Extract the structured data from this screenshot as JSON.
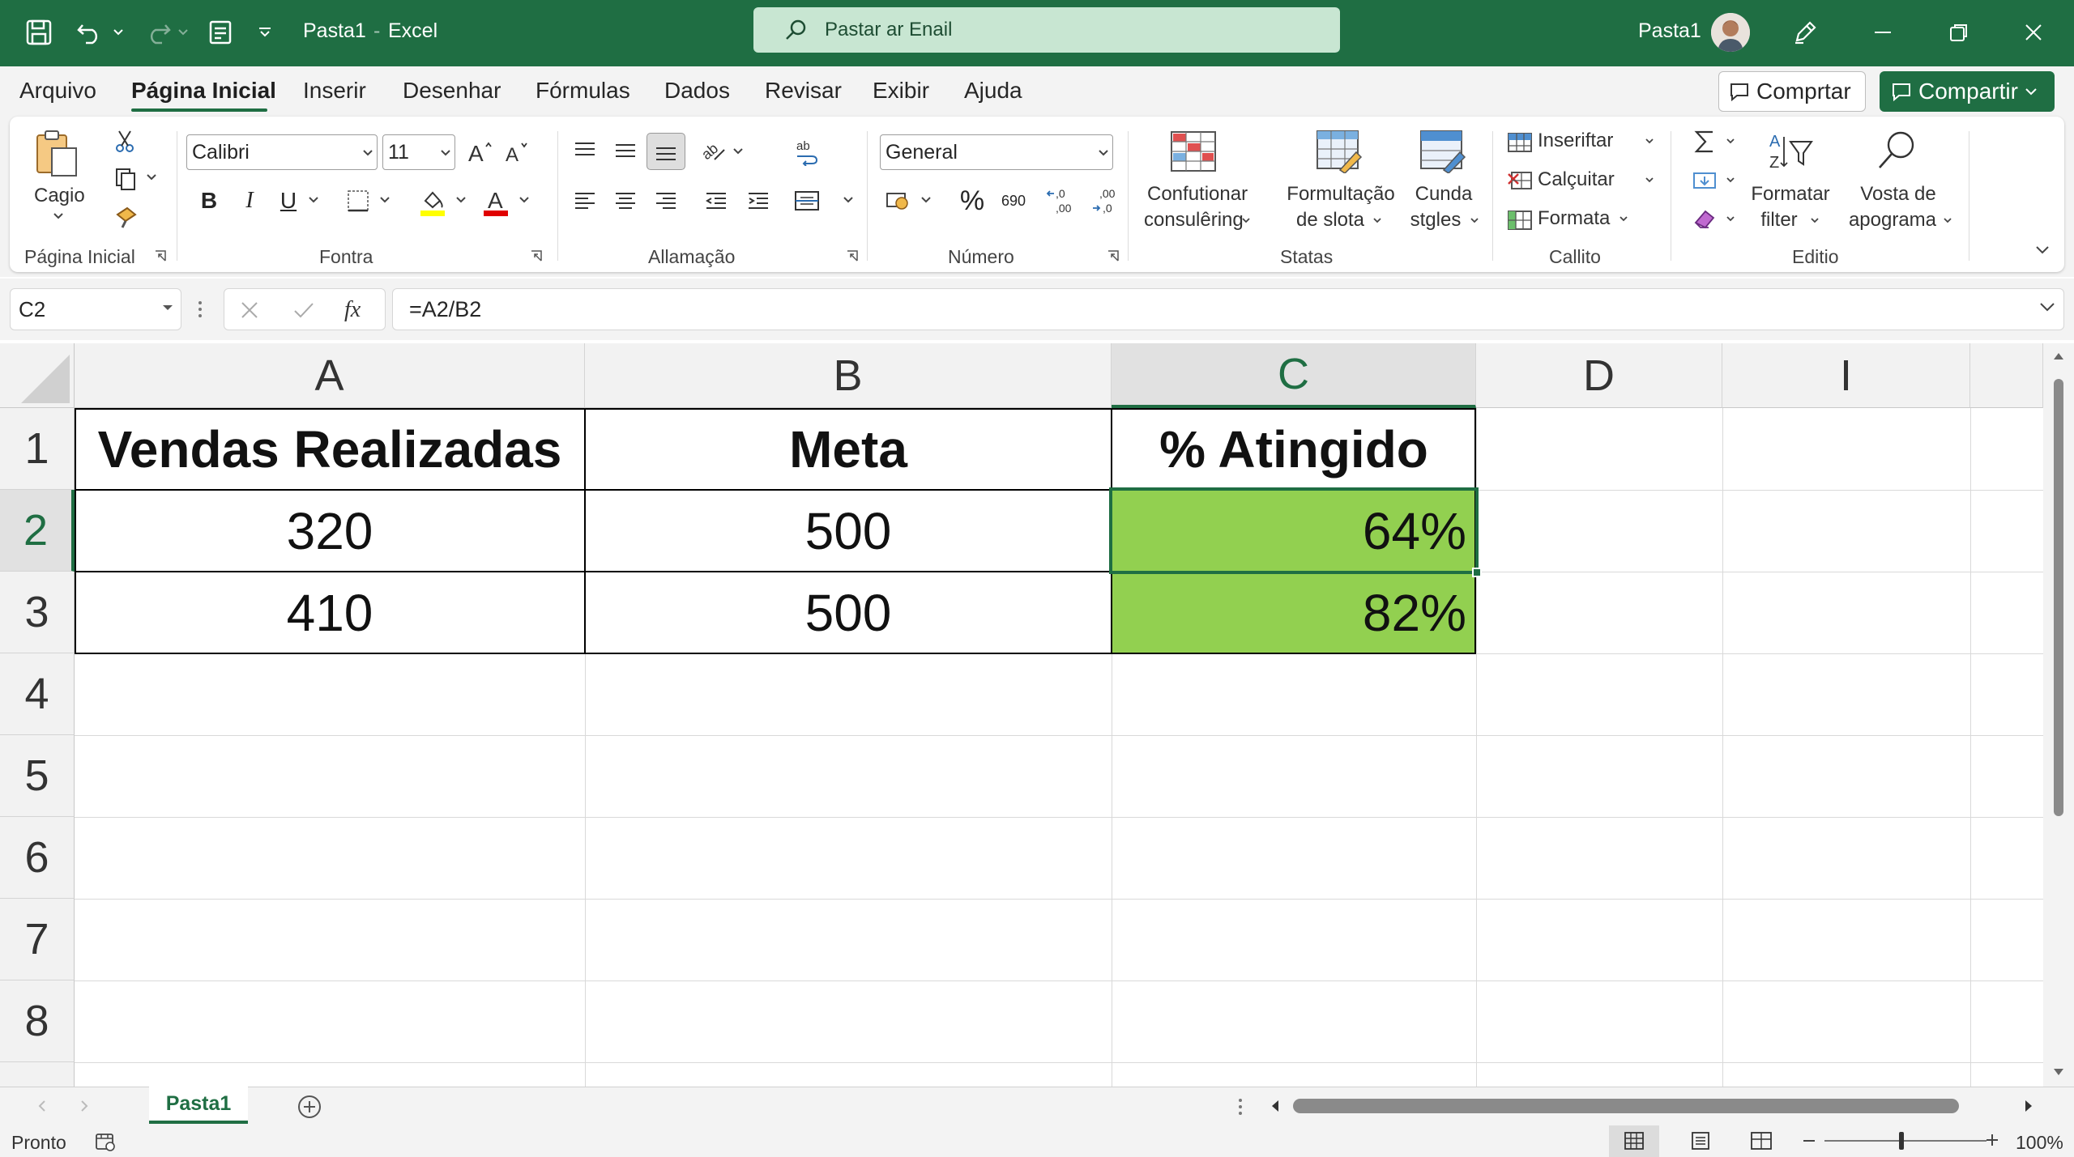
{
  "window": {
    "doc_title": "Pasta1",
    "app_name": "Excel",
    "search_placeholder": "Pastar ar Enail",
    "user_name": "Pasta1"
  },
  "menu": {
    "items": [
      "Arquivo",
      "Página Inicial",
      "Inserir",
      "Desenhar",
      "Fórmulas",
      "Dados",
      "Revisar",
      "Exibir",
      "Ajuda"
    ],
    "active": "Página Inicial",
    "comment_label": "Comprtar",
    "share_label": "Compartir"
  },
  "ribbon": {
    "clipboard": {
      "paste_label": "Cagio",
      "group_label": "Página Inicial"
    },
    "font": {
      "name": "Calibri",
      "size": "11",
      "group_label": "Fontra",
      "bold": "B",
      "italic": "I",
      "underline": "U"
    },
    "alignment": {
      "group_label": "Allamação"
    },
    "number": {
      "format": "General",
      "percent": "%",
      "thousands": "690",
      "group_label": "Número"
    },
    "styles": {
      "cond_format_1": "Confutionar",
      "cond_format_2": "consulêring",
      "format_table_1": "Formultação",
      "format_table_2": "de slota",
      "cell_styles_1": "Cunda",
      "cell_styles_2": "stgles",
      "group_label": "Statas"
    },
    "cells": {
      "insert": "Inseriftar",
      "delete": "Calçuitar",
      "format": "Formata",
      "group_label": "Callito"
    },
    "editing": {
      "sort_filter_1": "Formatar",
      "sort_filter_2": "filter",
      "find_1": "Vosta de",
      "find_2": "apograma",
      "group_label": "Editio"
    }
  },
  "formula_bar": {
    "name_box": "C2",
    "formula": "=A2/B2"
  },
  "grid": {
    "columns": [
      "A",
      "B",
      "C",
      "D",
      "I"
    ],
    "rows": [
      "1",
      "2",
      "3",
      "4",
      "5",
      "6",
      "7",
      "8"
    ],
    "selected_cell": "C2",
    "fill_color": "#92d050",
    "cells": {
      "a1": "Vendas Realizadas",
      "b1": "Meta",
      "c1": "% Atingido",
      "a2": "320",
      "b2": "500",
      "c2": "64%",
      "a3": "410",
      "b3": "500",
      "c3": "82%"
    }
  },
  "sheet_tabs": {
    "tabs": [
      "Pasta1"
    ],
    "active": "Pasta1"
  },
  "status_bar": {
    "status": "Pronto",
    "zoom": "100%"
  },
  "colors": {
    "accent": "#1f6e43",
    "search_bg": "#c8e6d2",
    "highlight_fill": "#92d050"
  }
}
